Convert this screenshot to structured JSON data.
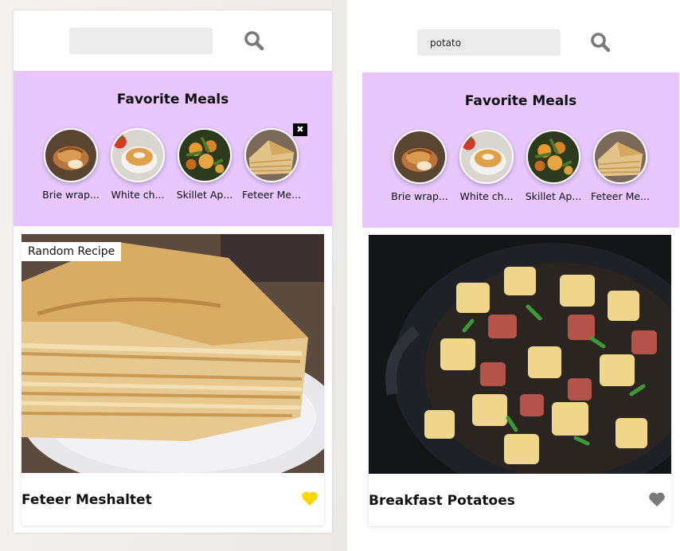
{
  "panels": [
    {
      "search": {
        "value": "",
        "placeholder": ""
      },
      "favorites": {
        "title": "Favorite Meals",
        "items": [
          {
            "name": "Brie wrap...",
            "icon": "brie-wrap-thumbnail"
          },
          {
            "name": "White ch...",
            "icon": "white-chocolate-thumbnail"
          },
          {
            "name": "Skillet Ap...",
            "icon": "skillet-apple-thumbnail"
          },
          {
            "name": "Feteer Me...",
            "icon": "feteer-thumbnail",
            "remove_label": "✖"
          }
        ]
      },
      "meal": {
        "tag": "Random Recipe",
        "name": "Feteer Meshaltet",
        "favorited": true,
        "heart_color": "#ffd700"
      }
    },
    {
      "search": {
        "value": "potato",
        "placeholder": ""
      },
      "favorites": {
        "title": "Favorite Meals",
        "items": [
          {
            "name": "Brie wrap...",
            "icon": "brie-wrap-thumbnail"
          },
          {
            "name": "White ch...",
            "icon": "white-chocolate-thumbnail"
          },
          {
            "name": "Skillet Ap...",
            "icon": "skillet-apple-thumbnail"
          },
          {
            "name": "Feteer Me...",
            "icon": "feteer-thumbnail"
          }
        ]
      },
      "meal": {
        "name": "Breakfast Potatoes",
        "favorited": false,
        "heart_color": "#7a7a7a"
      }
    }
  ],
  "colors": {
    "fav_panel_bg": "#e7c7fd",
    "search_icon": "#7a7a7a",
    "input_bg": "#ececec"
  }
}
